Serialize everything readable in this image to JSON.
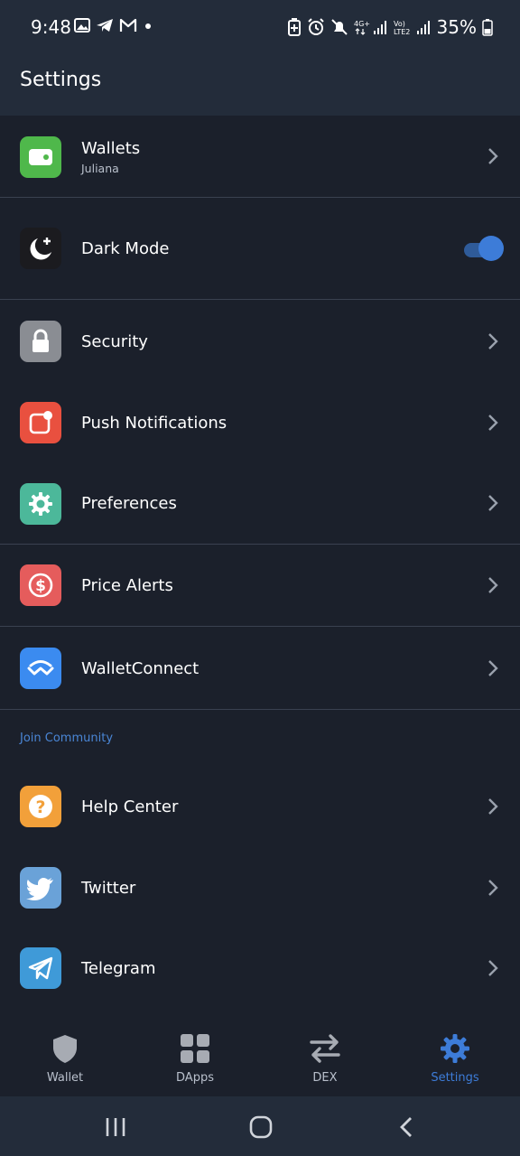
{
  "status_bar": {
    "time": "9:48",
    "battery": "35%"
  },
  "header": {
    "title": "Settings"
  },
  "rows": {
    "wallets": {
      "label": "Wallets",
      "sub": "Juliana"
    },
    "dark_mode": {
      "label": "Dark Mode",
      "toggle_on": true
    },
    "security": {
      "label": "Security"
    },
    "push": {
      "label": "Push Notifications"
    },
    "preferences": {
      "label": "Preferences"
    },
    "price_alerts": {
      "label": "Price Alerts"
    },
    "walletconnect": {
      "label": "WalletConnect"
    }
  },
  "community": {
    "header": "Join Community",
    "help": {
      "label": "Help Center"
    },
    "twitter": {
      "label": "Twitter"
    },
    "telegram": {
      "label": "Telegram"
    }
  },
  "bottom_nav": {
    "items": [
      {
        "label": "Wallet",
        "icon": "shield-icon"
      },
      {
        "label": "DApps",
        "icon": "grid-icon"
      },
      {
        "label": "DEX",
        "icon": "swap-arrows-icon"
      },
      {
        "label": "Settings",
        "icon": "gear-icon",
        "active": true
      }
    ]
  },
  "colors": {
    "background": "#1b202b",
    "header": "#232c3a",
    "accent": "#3d7cd8",
    "wallets_icon": "#4fb84b",
    "security_icon": "#8a8d93",
    "push_icon": "#e9503f",
    "preferences_icon": "#4cb89a",
    "price_alerts_icon": "#e55c5c",
    "walletconnect_icon": "#3b8bf0",
    "help_icon": "#f2a03a",
    "twitter_icon": "#6aa2d8",
    "telegram_icon": "#3f9ad8"
  }
}
